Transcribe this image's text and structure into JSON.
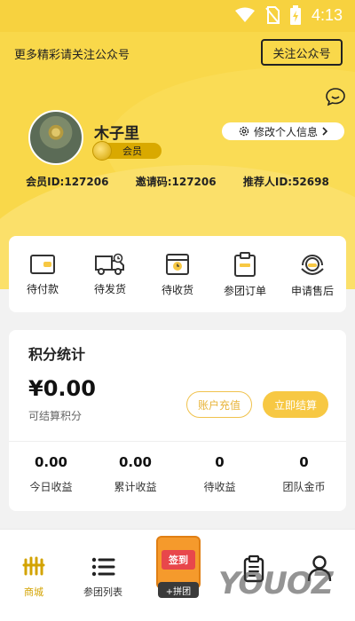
{
  "status_bar": {
    "time": "4:13"
  },
  "header": {
    "promo_text": "更多精彩请关注公众号",
    "follow_button": "关注公众号"
  },
  "profile": {
    "name": "木子里",
    "member_label": "会员",
    "edit_label": "修改个人信息",
    "member_id": "会员ID:127206",
    "invite_code": "邀请码:127206",
    "referrer_id": "推荐人ID:52698"
  },
  "orders": [
    {
      "label": "待付款",
      "icon": "wallet-icon"
    },
    {
      "label": "待发货",
      "icon": "truck-icon"
    },
    {
      "label": "待收货",
      "icon": "package-icon"
    },
    {
      "label": "参团订单",
      "icon": "clipboard-icon"
    },
    {
      "label": "申请售后",
      "icon": "headset-icon"
    }
  ],
  "points": {
    "title": "积分统计",
    "amount": "¥0.00",
    "subtitle": "可结算积分",
    "recharge_button": "账户充值",
    "settle_button": "立即结算",
    "stats": [
      {
        "value": "0.00",
        "label": "今日收益"
      },
      {
        "value": "0.00",
        "label": "累计收益"
      },
      {
        "value": "0",
        "label": "待收益"
      },
      {
        "value": "0",
        "label": "团队金币"
      }
    ]
  },
  "bottom_nav": {
    "items": [
      {
        "label": "商城",
        "icon": "mall-icon",
        "active": true
      },
      {
        "label": "参团列表",
        "icon": "list-icon",
        "active": false
      },
      {
        "label": "",
        "icon": "clipboard-icon",
        "active": false
      },
      {
        "label": "",
        "icon": "person-icon",
        "active": false
      }
    ],
    "promo_sign": "签到",
    "promo_tag": "+拼团"
  },
  "watermark": "YOUOZ",
  "colors": {
    "accent": "#f9d84a",
    "brand_gold": "#d3a300",
    "button_yellow": "#f7c843"
  }
}
